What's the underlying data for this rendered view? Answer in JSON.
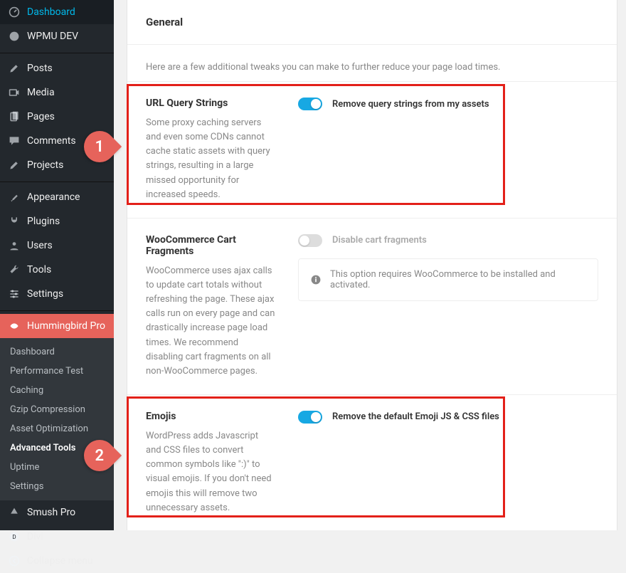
{
  "sidebar": {
    "items": [
      {
        "label": "Dashboard",
        "icon": "dashboard-icon"
      },
      {
        "label": "WPMU DEV",
        "icon": "wpmudev-icon"
      },
      {
        "label": "Posts",
        "icon": "pin-icon"
      },
      {
        "label": "Media",
        "icon": "media-icon"
      },
      {
        "label": "Pages",
        "icon": "pages-icon"
      },
      {
        "label": "Comments",
        "icon": "comment-icon"
      },
      {
        "label": "Projects",
        "icon": "pin-icon"
      },
      {
        "label": "Appearance",
        "icon": "brush-icon"
      },
      {
        "label": "Plugins",
        "icon": "plug-icon"
      },
      {
        "label": "Users",
        "icon": "user-icon"
      },
      {
        "label": "Tools",
        "icon": "wrench-icon"
      },
      {
        "label": "Settings",
        "icon": "sliders-icon"
      },
      {
        "label": "Hummingbird Pro",
        "icon": "hummingbird-icon"
      },
      {
        "label": "Smush Pro",
        "icon": "smush-icon"
      },
      {
        "label": "Divi",
        "icon": "divi-icon"
      },
      {
        "label": "Collapse menu",
        "icon": "collapse-icon"
      }
    ],
    "submenu": [
      "Dashboard",
      "Performance Test",
      "Caching",
      "Gzip Compression",
      "Asset Optimization",
      "Advanced Tools",
      "Uptime",
      "Settings"
    ],
    "submenu_current_index": 5
  },
  "panel": {
    "title": "General",
    "intro": "Here are a few additional tweaks you can make to further reduce your page load times.",
    "settings": [
      {
        "title": "URL Query Strings",
        "desc": "Some proxy caching servers and even some CDNs cannot cache static assets with query strings, resulting in a large missed opportunity for increased speeds.",
        "toggle_on": true,
        "toggle_label": "Remove query strings from my assets"
      },
      {
        "title": "WooCommerce Cart Fragments",
        "desc": "WooCommerce uses ajax calls to update cart totals without refreshing the page. These ajax calls run on every page and can drastically increase page load times. We recommend disabling cart fragments on all non-WooCommerce pages.",
        "toggle_on": false,
        "toggle_label": "Disable cart fragments",
        "notice": "This option requires WooCommerce to be installed and activated."
      },
      {
        "title": "Emojis",
        "desc": "WordPress adds Javascript and CSS files to convert common symbols like \":)\" to visual emojis. If you don't need emojis this will remove two unnecessary assets.",
        "toggle_on": true,
        "toggle_label": "Remove the default Emoji JS & CSS files"
      }
    ]
  },
  "callouts": {
    "one": "1",
    "two": "2"
  }
}
